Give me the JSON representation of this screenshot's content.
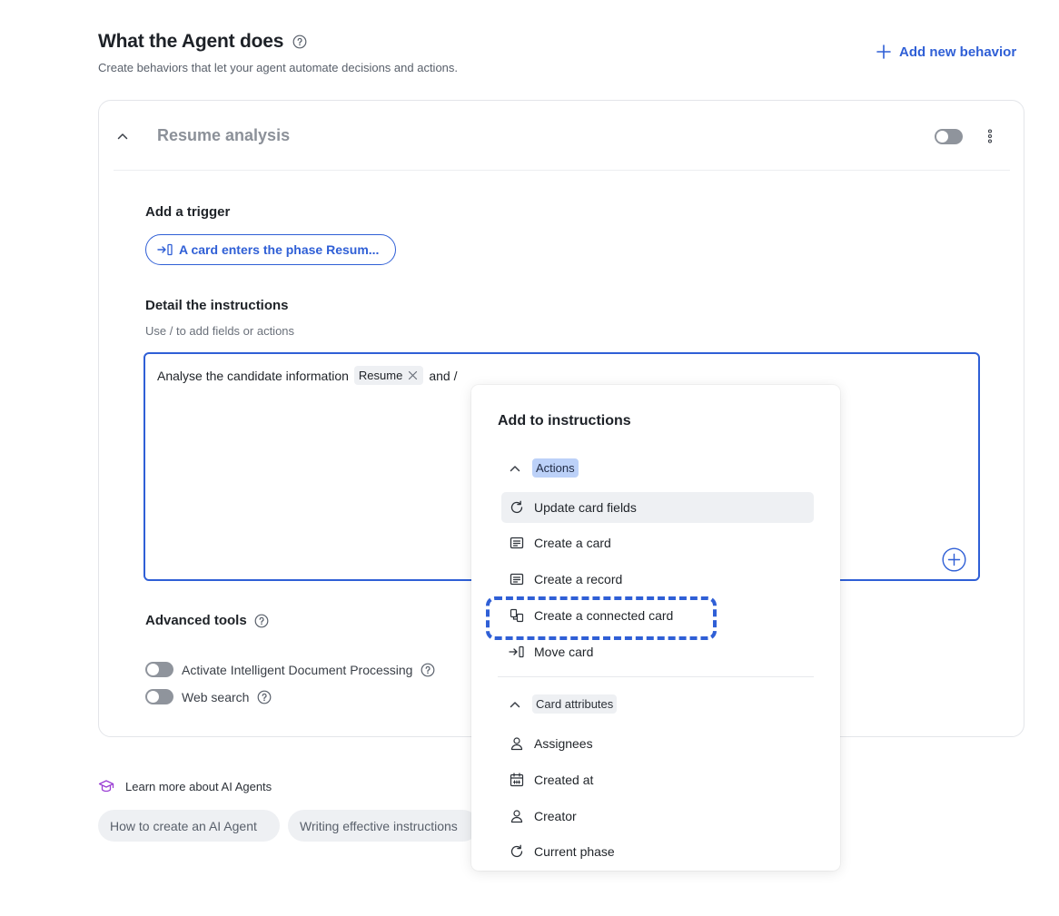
{
  "header": {
    "title": "What the Agent does",
    "subtitle": "Create behaviors that let your agent automate decisions and actions.",
    "add_behavior_label": "Add new behavior",
    "accent_color": "#2f5fd6"
  },
  "behavior": {
    "name": "Resume analysis",
    "enabled": false,
    "trigger_label": "Add a trigger",
    "trigger_value": "A card enters the phase Resum...",
    "instructions_label": "Detail the instructions",
    "instructions_hint": "Use / to add fields or actions",
    "editor": {
      "text_before": "Analyse the candidate information",
      "chip": "Resume",
      "text_after": "and /"
    },
    "advanced_label": "Advanced tools",
    "tools": [
      {
        "label": "Activate Intelligent Document Processing",
        "enabled": false
      },
      {
        "label": "Web search",
        "enabled": false
      }
    ]
  },
  "learn": {
    "label": "Learn more about AI Agents",
    "links": [
      "How to create an AI Agent",
      "Writing effective instructions"
    ]
  },
  "popup": {
    "title": "Add to instructions",
    "groups": [
      {
        "name": "Actions",
        "items": [
          {
            "label": "Update card fields",
            "icon": "refresh-icon"
          },
          {
            "label": "Create a card",
            "icon": "card-icon"
          },
          {
            "label": "Create a record",
            "icon": "record-icon"
          },
          {
            "label": "Create a connected card",
            "icon": "connected-card-icon"
          },
          {
            "label": "Move card",
            "icon": "move-icon"
          }
        ]
      },
      {
        "name": "Card attributes",
        "items": [
          {
            "label": "Assignees",
            "icon": "person-icon"
          },
          {
            "label": "Created at",
            "icon": "calendar-icon"
          },
          {
            "label": "Creator",
            "icon": "person-icon"
          },
          {
            "label": "Current phase",
            "icon": "refresh-icon"
          }
        ]
      }
    ]
  }
}
